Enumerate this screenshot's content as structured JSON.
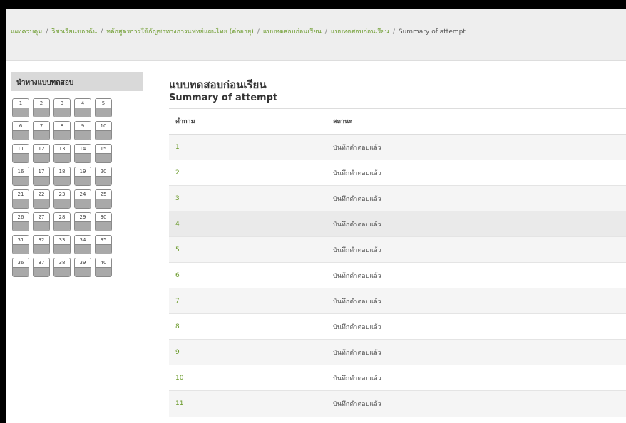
{
  "breadcrumb": {
    "items": [
      "แผงควบคุม",
      "วิชาเรียนของฉัน",
      "หลักสูตรการใช้กัญชาทางการแพทย์แผนไทย (ต่ออายุ)",
      "แบบทดสอบก่อนเรียน",
      "แบบทดสอบก่อนเรียน"
    ],
    "current": "Summary of attempt",
    "separator": "/"
  },
  "quiz_nav": {
    "title": "นำทางแบบทดสอบ",
    "questions": [
      "1",
      "2",
      "3",
      "4",
      "5",
      "6",
      "7",
      "8",
      "9",
      "10",
      "11",
      "12",
      "13",
      "14",
      "15",
      "16",
      "17",
      "18",
      "19",
      "20",
      "21",
      "22",
      "23",
      "24",
      "25",
      "26",
      "27",
      "28",
      "29",
      "30",
      "31",
      "32",
      "33",
      "34",
      "35",
      "36",
      "37",
      "38",
      "39",
      "40"
    ]
  },
  "main": {
    "title": "แบบทดสอบก่อนเรียน",
    "subtitle": "Summary of attempt",
    "table": {
      "headers": [
        "คำถาม",
        "สถานะ"
      ],
      "rows": [
        {
          "q": "1",
          "status": "บันทึกคำตอบแล้ว"
        },
        {
          "q": "2",
          "status": "บันทึกคำตอบแล้ว"
        },
        {
          "q": "3",
          "status": "บันทึกคำตอบแล้ว"
        },
        {
          "q": "4",
          "status": "บันทึกคำตอบแล้ว"
        },
        {
          "q": "5",
          "status": "บันทึกคำตอบแล้ว"
        },
        {
          "q": "6",
          "status": "บันทึกคำตอบแล้ว"
        },
        {
          "q": "7",
          "status": "บันทึกคำตอบแล้ว"
        },
        {
          "q": "8",
          "status": "บันทึกคำตอบแล้ว"
        },
        {
          "q": "9",
          "status": "บันทึกคำตอบแล้ว"
        },
        {
          "q": "10",
          "status": "บันทึกคำตอบแล้ว"
        },
        {
          "q": "11",
          "status": "บันทึกคำตอบแล้ว"
        }
      ]
    }
  },
  "colors": {
    "link": "#6a9a2a",
    "header_bg": "#eeeeee",
    "nav_header_bg": "#d9d9d9",
    "answered_state": "#a9a9a9"
  }
}
